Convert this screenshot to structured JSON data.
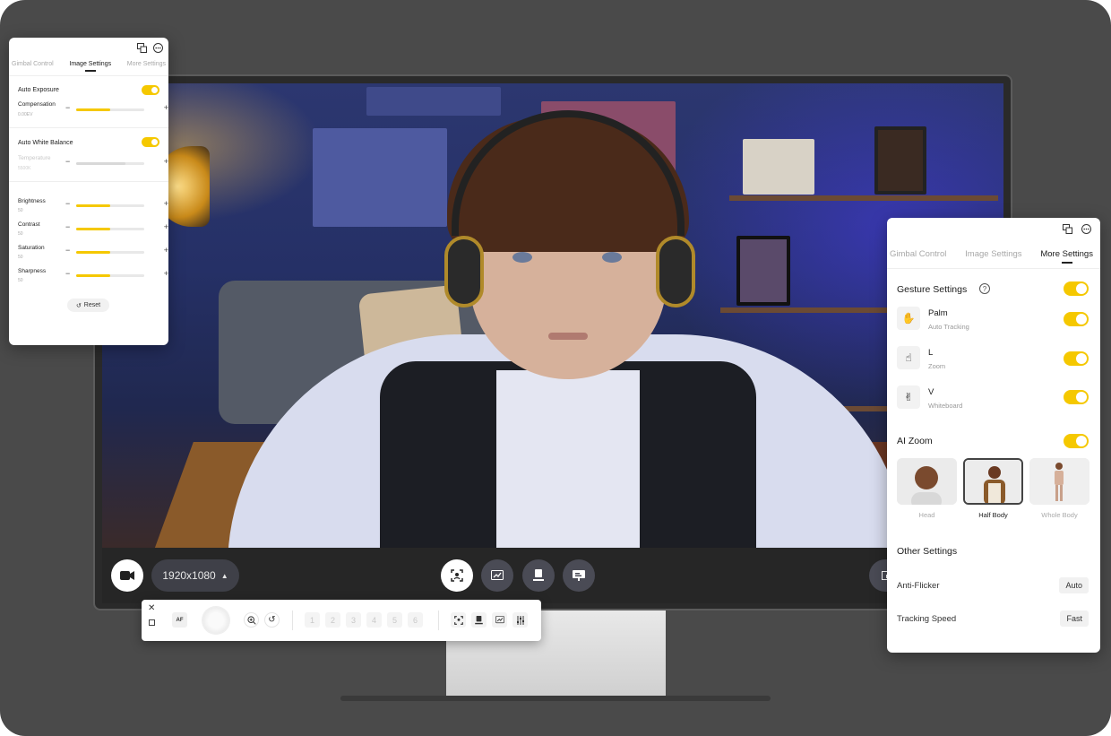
{
  "colors": {
    "accent": "#f5c800",
    "background": "#4a4a4a",
    "panel": "#ffffff"
  },
  "left_panel": {
    "tabs": [
      {
        "label": "Gimbal Control",
        "active": false
      },
      {
        "label": "Image Settings",
        "active": true
      },
      {
        "label": "More Settings",
        "active": false
      }
    ],
    "auto_exposure": {
      "label": "Auto Exposure",
      "on": true
    },
    "compensation": {
      "label": "Compensation",
      "value": "0.00EV",
      "level": 0.5
    },
    "auto_white_balance": {
      "label": "Auto White Balance",
      "on": true
    },
    "temperature": {
      "label": "Temperature",
      "value": "5500K",
      "level": 0.72,
      "disabled": true
    },
    "brightness": {
      "label": "Brightness",
      "value": "50",
      "level": 0.5
    },
    "contrast": {
      "label": "Contrast",
      "value": "50",
      "level": 0.5
    },
    "saturation": {
      "label": "Saturation",
      "value": "50",
      "level": 0.5
    },
    "sharpness": {
      "label": "Sharpness",
      "value": "50",
      "level": 0.5
    },
    "reset_label": "Reset"
  },
  "right_panel": {
    "tabs": [
      {
        "label": "Gimbal Control",
        "active": false
      },
      {
        "label": "Image Settings",
        "active": false
      },
      {
        "label": "More Settings",
        "active": true
      }
    ],
    "gesture_settings": {
      "label": "Gesture Settings",
      "on": true
    },
    "gestures": [
      {
        "name": "Palm",
        "desc": "Auto Tracking",
        "icon": "palm-hand-icon",
        "on": true
      },
      {
        "name": "L",
        "desc": "Zoom",
        "icon": "l-hand-icon",
        "on": true
      },
      {
        "name": "V",
        "desc": "Whiteboard",
        "icon": "v-hand-icon",
        "on": true
      }
    ],
    "ai_zoom": {
      "label": "AI Zoom",
      "on": true
    },
    "zoom_options": [
      {
        "label": "Head",
        "selected": false
      },
      {
        "label": "Half Body",
        "selected": true
      },
      {
        "label": "Whole Body",
        "selected": false
      }
    ],
    "other_settings": {
      "label": "Other Settings"
    },
    "anti_flicker": {
      "label": "Anti-Flicker",
      "value": "Auto"
    },
    "tracking_speed": {
      "label": "Tracking Speed",
      "value": "Fast"
    }
  },
  "app_bar": {
    "resolution": "1920x1080"
  },
  "toolbar": {
    "af_label": "AF",
    "presets": [
      "1",
      "2",
      "3",
      "4",
      "5",
      "6"
    ]
  }
}
